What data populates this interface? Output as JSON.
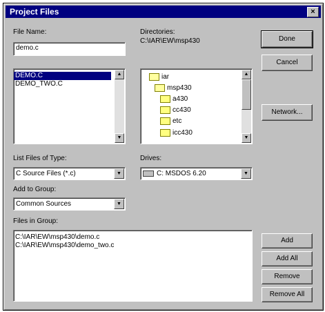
{
  "window": {
    "title": "Project Files",
    "close_glyph": "×"
  },
  "file_name": {
    "label": "File Name:",
    "value": "demo.c"
  },
  "directories": {
    "label": "Directories:",
    "path": "C:\\IAR\\EW\\msp430"
  },
  "files_list": {
    "items": [
      "DEMO.C",
      "DEMO_TWO.C"
    ],
    "selected_index": 0
  },
  "dir_tree": {
    "items": [
      {
        "label": "iar",
        "icon": "open-folder-icon"
      },
      {
        "label": "msp430",
        "icon": "open-folder-icon"
      },
      {
        "label": "a430",
        "icon": "folder-icon"
      },
      {
        "label": "cc430",
        "icon": "folder-icon"
      },
      {
        "label": "etc",
        "icon": "folder-icon"
      },
      {
        "label": "icc430",
        "icon": "folder-icon"
      }
    ]
  },
  "list_type": {
    "label": "List Files of Type:",
    "value": "C Source Files (*.c)"
  },
  "drives": {
    "label": "Drives:",
    "value": "C: MSDOS 6.20"
  },
  "add_to_group": {
    "label": "Add to Group:",
    "value": "Common Sources"
  },
  "files_in_group": {
    "label": "Files in Group:",
    "items": [
      "C:\\IAR\\EW\\msp430\\demo.c",
      "C:\\IAR\\EW\\msp430\\demo_two.c"
    ]
  },
  "buttons": {
    "done": "Done",
    "cancel": "Cancel",
    "network": "Network...",
    "add": "Add",
    "add_all": "Add All",
    "remove": "Remove",
    "remove_all": "Remove All"
  },
  "colors": {
    "title_bar": "#000080",
    "selection": "#000080",
    "dialog_face": "#c0c0c0"
  }
}
